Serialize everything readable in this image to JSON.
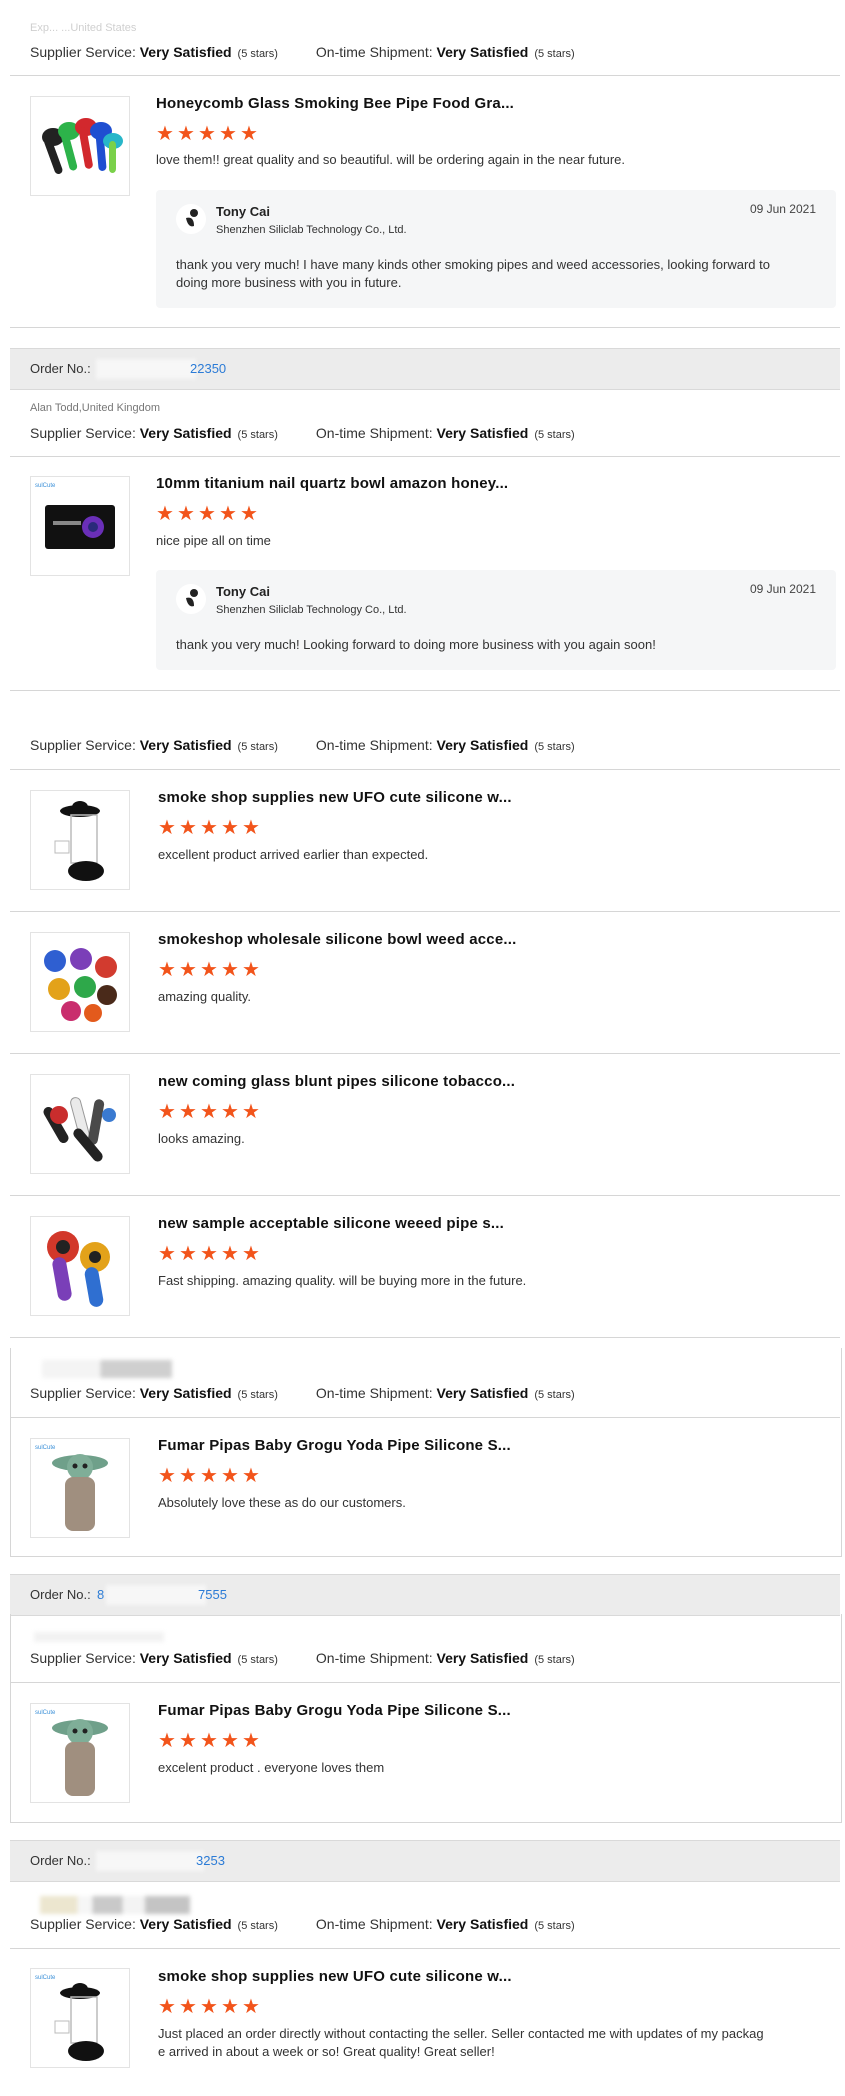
{
  "labels": {
    "supplier_service": "Supplier Service:",
    "on_time_shipment": "On-time Shipment:",
    "very_satisfied": "Very Satisfied",
    "five_stars": "(5 stars)",
    "order_no": "Order No.:"
  },
  "top_buyer_partial": "Exp... ...United States",
  "reviews": [
    {
      "title": "Honeycomb Glass Smoking Bee Pipe Food Gra...",
      "rating": 5,
      "text": "love them!! great quality and so beautiful. will be ordering again in the near future.",
      "reply": {
        "name": "Tony Cai",
        "company": "Shenzhen Siliclab Technology Co., Ltd.",
        "date": "09 Jun 2021",
        "line1": "thank you very much! I have many kinds other smoking pipes and weed accessories, looking forward to",
        "line2": "doing more business with you in future."
      }
    }
  ],
  "order2": {
    "number_suffix": "22350",
    "buyer": "Alan Todd,United Kingdom",
    "title": "10mm titanium nail quartz bowl amazon honey...",
    "text": "nice pipe all on time",
    "reply": {
      "name": "Tony Cai",
      "company": "Shenzhen Siliclab Technology Co., Ltd.",
      "date": "09 Jun 2021",
      "line1": "thank you very much! Looking forward to doing more business with you again soon!"
    }
  },
  "order3": {
    "items": [
      {
        "title": "smoke shop supplies new UFO cute silicone w...",
        "text": "excellent product arrived earlier than expected."
      },
      {
        "title": "smokeshop wholesale silicone bowl weed acce...",
        "text": "amazing quality."
      },
      {
        "title": "new coming glass blunt pipes silicone tobacco...",
        "text": "looks amazing."
      },
      {
        "title": "new sample acceptable silicone weeed pipe s...",
        "text": "Fast shipping. amazing quality. will be buying more in the future."
      }
    ]
  },
  "order4": {
    "title": "Fumar Pipas Baby Grogu Yoda Pipe Silicone S...",
    "text": "Absolutely love these as do our customers."
  },
  "order5": {
    "number_prefix": "8",
    "number_suffix": "7555",
    "title": "Fumar Pipas Baby Grogu Yoda Pipe Silicone S...",
    "text": "excelent product . everyone loves them"
  },
  "order6": {
    "number_suffix": "3253",
    "title": "smoke shop supplies new UFO cute silicone w...",
    "line1": "Just placed an order directly without contacting the seller. Seller contacted me with updates of my packag",
    "line2": "e arrived in about a week or so! Great quality! Great seller!"
  },
  "colors": {
    "star": "#f2541b",
    "link": "#2b7bd6",
    "order_bar": "#ececec"
  }
}
